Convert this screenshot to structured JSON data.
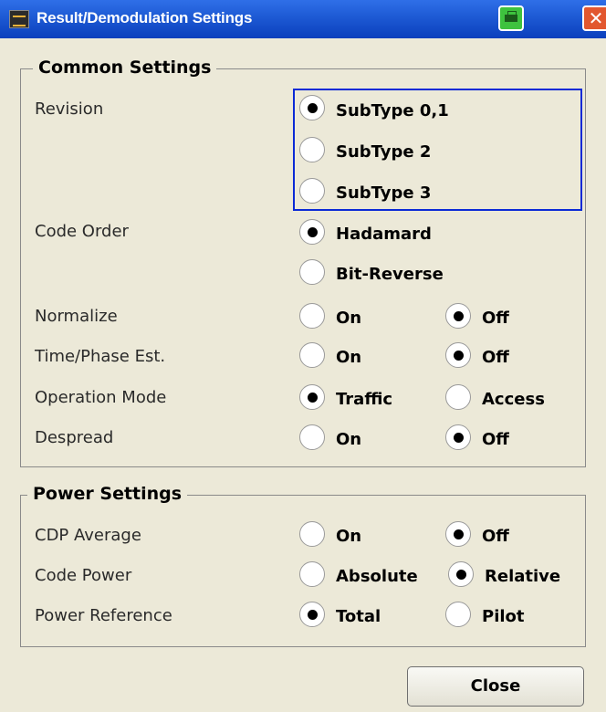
{
  "window": {
    "title": "Result/Demodulation Settings"
  },
  "common": {
    "legend": "Common Settings",
    "revision": {
      "label": "Revision",
      "options": [
        "SubType 0,1",
        "SubType 2",
        "SubType 3"
      ],
      "selected": "SubType 0,1"
    },
    "code_order": {
      "label": "Code Order",
      "options": [
        "Hadamard",
        "Bit-Reverse"
      ],
      "selected": "Hadamard"
    },
    "normalize": {
      "label": "Normalize",
      "options": [
        "On",
        "Off"
      ],
      "selected": "Off"
    },
    "time_phase": {
      "label": "Time/Phase Est.",
      "options": [
        "On",
        "Off"
      ],
      "selected": "Off"
    },
    "operation_mode": {
      "label": "Operation Mode",
      "options": [
        "Traffic",
        "Access"
      ],
      "selected": "Traffic"
    },
    "despread": {
      "label": "Despread",
      "options": [
        "On",
        "Off"
      ],
      "selected": "Off"
    }
  },
  "power": {
    "legend": "Power Settings",
    "cdp_average": {
      "label": "CDP Average",
      "options": [
        "On",
        "Off"
      ],
      "selected": "Off"
    },
    "code_power": {
      "label": "Code Power",
      "options": [
        "Absolute",
        "Relative"
      ],
      "selected": "Relative"
    },
    "power_reference": {
      "label": "Power Reference",
      "options": [
        "Total",
        "Pilot"
      ],
      "selected": "Total"
    }
  },
  "buttons": {
    "close": "Close"
  },
  "icons": {
    "app": "spectrum-app-icon",
    "print": "printer-icon",
    "close": "close-icon"
  }
}
